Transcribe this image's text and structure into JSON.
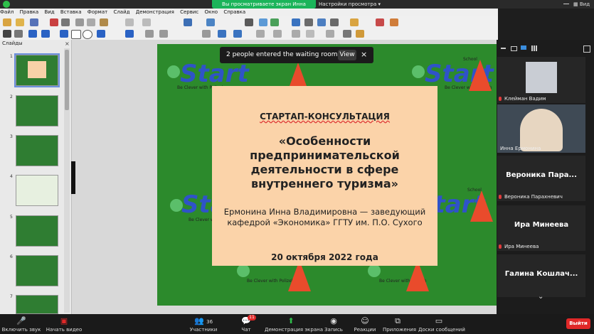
{
  "zoom_top": {
    "share_banner": "Вы просматриваете экран Инна Ермонина",
    "view_settings": "Настройки просмотра",
    "view_label": "Вид"
  },
  "menubar": {
    "items": [
      "Файл",
      "Правка",
      "Вид",
      "Вставка",
      "Формат",
      "Слайд",
      "Демонстрация",
      "Сервис",
      "Окно",
      "Справка"
    ]
  },
  "slides_panel": {
    "title": "Слайды",
    "numbers": [
      "1",
      "2",
      "3",
      "4",
      "5",
      "6",
      "7"
    ]
  },
  "toast": {
    "message": "2 people entered the waiting room",
    "view_button": "View"
  },
  "slide": {
    "heading": "СТАРТАП-КОНСУЛЬТАЦИЯ",
    "title": "«Особенности предпринимательской деятельности в сфере внутреннего туризма»",
    "author": "Ермонина Инна Владимировна — заведующий кафедрой «Экономика» ГГТУ им. П.О. Сухого",
    "date": "20 октября 2022 года",
    "logo_text": "Start",
    "logo_sub": "School",
    "slogan": "Be Clever with Polizeh"
  },
  "participants": [
    {
      "name": "Клейман Вадим"
    },
    {
      "name": "Инна Ермонина"
    },
    {
      "big": "Вероника Пара...",
      "name": "Вероника Парахневич"
    },
    {
      "big": "Ира Минеева",
      "name": "Ира Минеева"
    },
    {
      "big": "Галина Кошлач..."
    }
  ],
  "bottom_bar": {
    "mute": "Включить звук",
    "video": "Начать видео",
    "participants": "Участники",
    "participants_count": "36",
    "chat": "Чат",
    "chat_badge": "11",
    "share": "Демонстрация экрана",
    "record": "Запись",
    "reactions": "Реакции",
    "apps": "Приложения",
    "whiteboards": "Доски сообщений",
    "leave": "Выйти"
  }
}
